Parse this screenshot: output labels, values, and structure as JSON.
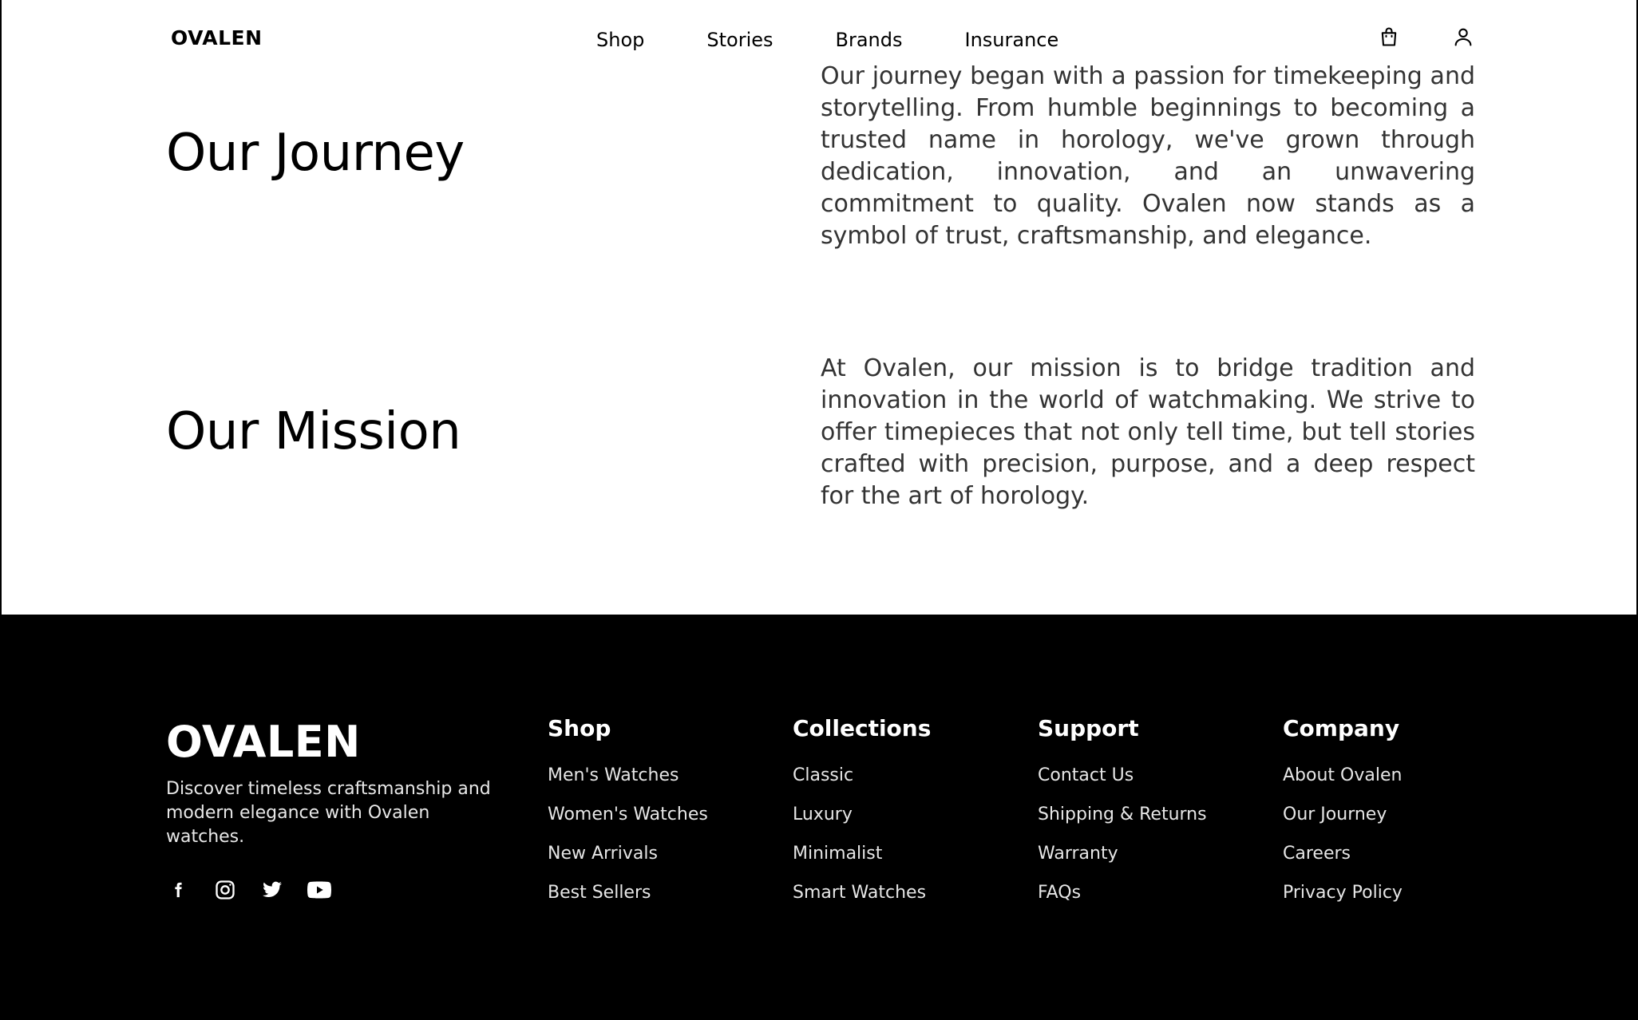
{
  "header": {
    "logo": "OVALEN",
    "nav": [
      "Shop",
      "Stories",
      "Brands",
      "Insurance"
    ],
    "icons": [
      "shopping-bag-icon",
      "user-icon"
    ]
  },
  "journey": {
    "title": "Our Journey",
    "text": "Our journey began with a passion for timekeeping and storytelling. From humble beginnings to becoming a trusted name in horology, we've grown through dedication, innovation, and an unwavering commitment to quality. Ovalen now stands as a symbol of trust, craftsmanship, and elegance."
  },
  "mission": {
    "title": "Our Mission",
    "text": "At Ovalen, our mission is to bridge tradition and innovation in the world of watchmaking. We strive to offer timepieces that not only tell time, but tell stories crafted with precision, purpose, and a deep respect for the art of horology."
  },
  "footer": {
    "logo": "OVALEN",
    "tagline": "Discover timeless craftsmanship and modern elegance with Ovalen watches.",
    "socials": [
      "facebook-icon",
      "instagram-icon",
      "twitter-icon",
      "youtube-icon"
    ],
    "columns": [
      {
        "title": "Shop",
        "links": [
          "Men's Watches",
          "Women's Watches",
          "New Arrivals",
          "Best Sellers"
        ]
      },
      {
        "title": "Collections",
        "links": [
          "Classic",
          "Luxury",
          "Minimalist",
          "Smart Watches"
        ]
      },
      {
        "title": "Support",
        "links": [
          "Contact Us",
          "Shipping & Returns",
          "Warranty",
          "FAQs"
        ]
      },
      {
        "title": "Company",
        "links": [
          "About Ovalen",
          "Our Journey",
          "Careers",
          "Privacy Policy"
        ]
      }
    ]
  },
  "colors": {
    "background": "#ffffff",
    "text": "#000000",
    "body_text": "#333333",
    "footer_bg": "#000000",
    "footer_text": "#ffffff"
  }
}
